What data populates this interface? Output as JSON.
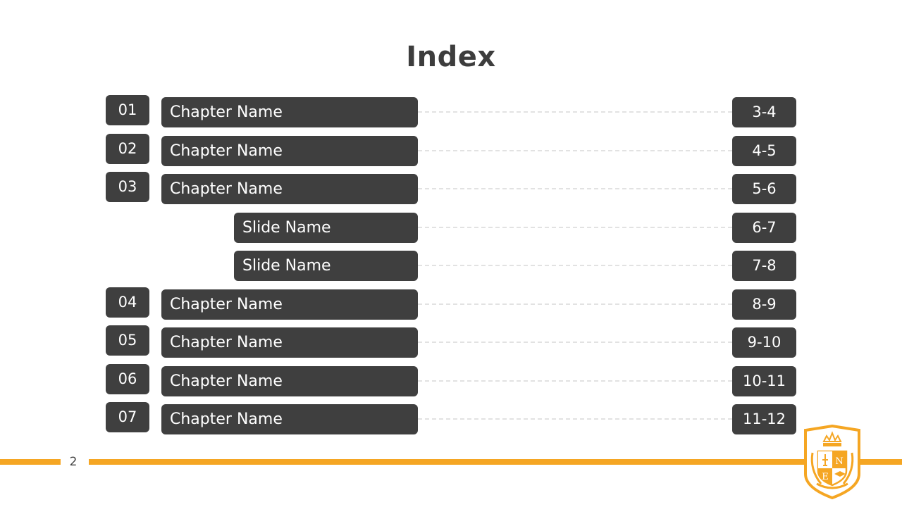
{
  "title": "Index",
  "entries": [
    {
      "type": "chapter",
      "number": "01",
      "name": "Chapter Name",
      "pages": "3-4"
    },
    {
      "type": "chapter",
      "number": "02",
      "name": "Chapter Name",
      "pages": "4-5"
    },
    {
      "type": "chapter",
      "number": "03",
      "name": "Chapter Name",
      "pages": "5-6"
    },
    {
      "type": "slide",
      "number": "",
      "name": "Slide Name",
      "pages": "6-7"
    },
    {
      "type": "slide",
      "number": "",
      "name": "Slide Name",
      "pages": "7-8"
    },
    {
      "type": "chapter",
      "number": "04",
      "name": "Chapter Name",
      "pages": "8-9"
    },
    {
      "type": "chapter",
      "number": "05",
      "name": "Chapter Name",
      "pages": "9-10"
    },
    {
      "type": "chapter",
      "number": "06",
      "name": "Chapter Name",
      "pages": "10-11"
    },
    {
      "type": "chapter",
      "number": "07",
      "name": "Chapter Name",
      "pages": "11-12"
    }
  ],
  "footer": {
    "page_number": "2",
    "logo_icon": "crest-shield-logo",
    "logo_letters": [
      "N",
      "E"
    ]
  },
  "colors": {
    "accent": "#f5a623",
    "box": "#3f3f3f",
    "title": "#3d3d3d"
  }
}
